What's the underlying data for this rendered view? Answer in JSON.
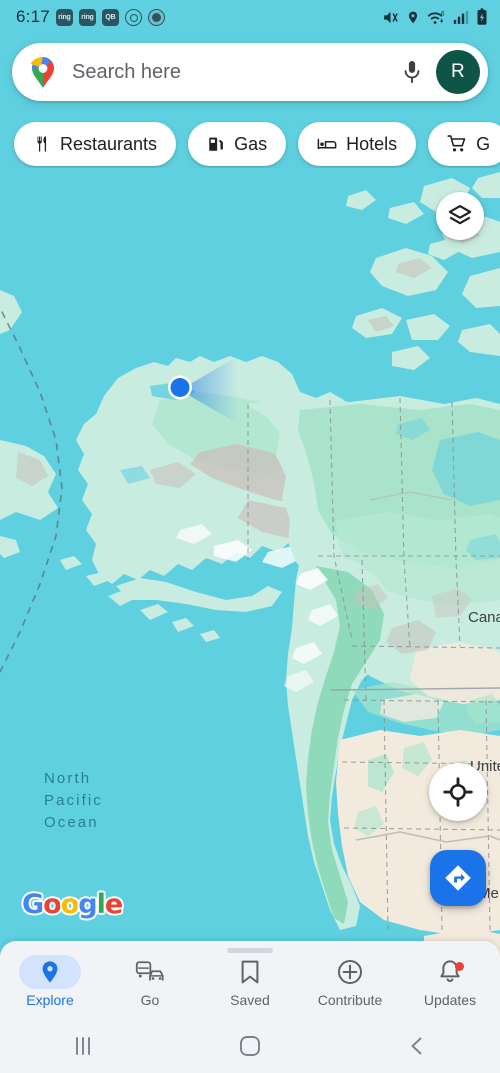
{
  "status_bar": {
    "time": "6:17",
    "notification_icons": [
      {
        "name": "ring-app-icon",
        "label": "ring"
      },
      {
        "name": "ring-app-icon",
        "label": "ring"
      },
      {
        "name": "keyboard-icon",
        "label": "QB"
      },
      {
        "name": "pinterest-icon",
        "label": ""
      },
      {
        "name": "avatar-notification-icon",
        "label": ""
      }
    ],
    "system_icons": [
      {
        "name": "mute-vibrate-icon"
      },
      {
        "name": "location-active-icon"
      },
      {
        "name": "wifi-6-icon",
        "label": "6"
      },
      {
        "name": "cellular-signal-icon"
      },
      {
        "name": "battery-charging-icon"
      }
    ]
  },
  "search": {
    "placeholder": "Search here",
    "value": "",
    "logo": "google-maps-pin-logo",
    "mic": "microphone-icon",
    "avatar_initial": "R",
    "avatar_color": "#0e5447"
  },
  "chips": [
    {
      "label": "Restaurants",
      "icon": "restaurant-icon"
    },
    {
      "label": "Gas",
      "icon": "gas-pump-icon"
    },
    {
      "label": "Hotels",
      "icon": "hotel-bed-icon"
    },
    {
      "label": "G",
      "icon": "grocery-cart-icon"
    }
  ],
  "map": {
    "ocean_label_lines": [
      "North",
      "Pacific",
      "Ocean"
    ],
    "country_labels": [
      {
        "name": "canada",
        "text": "Cana"
      },
      {
        "name": "united-states",
        "text": "Unite"
      },
      {
        "name": "mexico",
        "text": "Me"
      }
    ],
    "watermark": "Google",
    "watermark_letters": [
      {
        "char": "G",
        "color": "#4285f4"
      },
      {
        "char": "o",
        "color": "#ea4335"
      },
      {
        "char": "o",
        "color": "#fbbc05"
      },
      {
        "char": "g",
        "color": "#4285f4"
      },
      {
        "char": "l",
        "color": "#34a853"
      },
      {
        "char": "e",
        "color": "#ea4335"
      }
    ],
    "ocean_color": "#5fd0e0",
    "land_color": "#c8ece0",
    "forest_color": "#9fe0c4",
    "arid_color": "#f3eade",
    "mountain_color": "#c9c3bd",
    "user_location": {
      "name": "user-location-dot",
      "color": "#1a73e8",
      "heading": "northeast"
    }
  },
  "controls": {
    "layers": {
      "name": "layers-button",
      "icon": "layers-icon"
    },
    "recenter": {
      "name": "recenter-button",
      "icon": "my-location-crosshair-icon"
    },
    "directions": {
      "name": "directions-button",
      "icon": "directions-arrow-icon",
      "color": "#1a73e8"
    }
  },
  "bottom_nav": {
    "items": [
      {
        "label": "Explore",
        "icon": "explore-pin-icon",
        "active": true
      },
      {
        "label": "Go",
        "icon": "go-transit-icon",
        "active": false
      },
      {
        "label": "Saved",
        "icon": "saved-bookmark-icon",
        "active": false
      },
      {
        "label": "Contribute",
        "icon": "contribute-plus-icon",
        "active": false
      },
      {
        "label": "Updates",
        "icon": "updates-bell-icon",
        "active": false,
        "badge": true
      }
    ],
    "active_color": "#1a73e8"
  },
  "android_nav": {
    "recents": "recents-icon",
    "home": "home-icon",
    "back": "back-icon"
  }
}
